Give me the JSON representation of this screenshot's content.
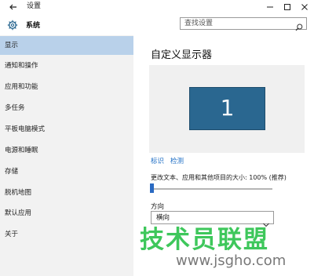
{
  "window": {
    "title": "设置"
  },
  "header": {
    "section": "系统",
    "search_placeholder": "查找设置"
  },
  "sidebar": {
    "items": [
      {
        "label": "显示",
        "active": true
      },
      {
        "label": "通知和操作"
      },
      {
        "label": "应用和功能"
      },
      {
        "label": "多任务"
      },
      {
        "label": "平板电脑模式"
      },
      {
        "label": "电源和睡眠"
      },
      {
        "label": "存储"
      },
      {
        "label": "脱机地图"
      },
      {
        "label": "默认应用"
      },
      {
        "label": "关于"
      }
    ]
  },
  "main": {
    "title": "自定义显示器",
    "monitor_number": "1",
    "links": {
      "identify": "标识",
      "detect": "检测"
    },
    "scale": {
      "label": "更改文本、应用和其他项目的大小: 100% (推荐)",
      "percent": 100
    },
    "orientation": {
      "label": "方向",
      "value": "横向"
    }
  },
  "watermark": {
    "text": "技术员联盟",
    "url": "www.jsgho.com"
  },
  "colors": {
    "accent": "#2a6790",
    "active_nav": "#b9d1ea",
    "link": "#1f6fc5",
    "watermark_green": "#2ec34e"
  }
}
